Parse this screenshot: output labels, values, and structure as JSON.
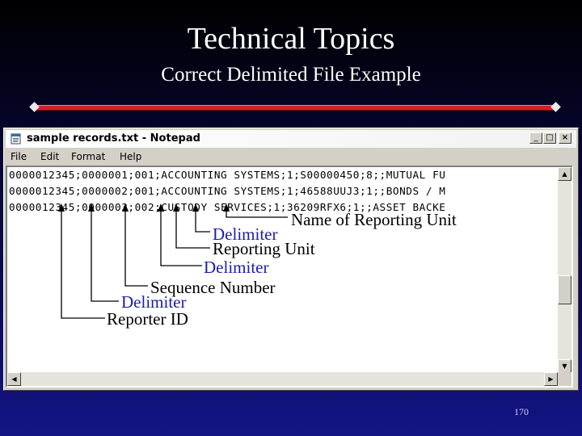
{
  "slide": {
    "title": "Technical Topics",
    "subtitle": "Correct Delimited File Example",
    "page_number": "170"
  },
  "window": {
    "title": "sample records.txt - Notepad",
    "controls": {
      "minimize": "_",
      "maximize": "□",
      "close": "×"
    },
    "menu": [
      "File",
      "Edit",
      "Format",
      "Help"
    ],
    "lines": [
      "0000012345;0000001;001;ACCOUNTING SYSTEMS;1;S00000450;8;;MUTUAL FU",
      "0000012345;0000002;001;ACCOUNTING SYSTEMS;1;46588UUJ3;1;;BONDS / M",
      "0000012345;0000003;002;CUSTODY SERVICES;1;36209RFX6;1;;ASSET BACKE"
    ]
  },
  "annotations": {
    "name_of_reporting_unit": "Name of Reporting Unit",
    "delimiter_1": "Delimiter",
    "reporting_unit": "Reporting Unit",
    "delimiter_2": "Delimiter",
    "sequence_number": "Sequence Number",
    "delimiter_3": "Delimiter",
    "reporter_id": "Reporter ID"
  },
  "colors": {
    "annotation_black": "#000000",
    "annotation_blue": "#1c1ca8",
    "divider_red": "#d31f2a"
  }
}
